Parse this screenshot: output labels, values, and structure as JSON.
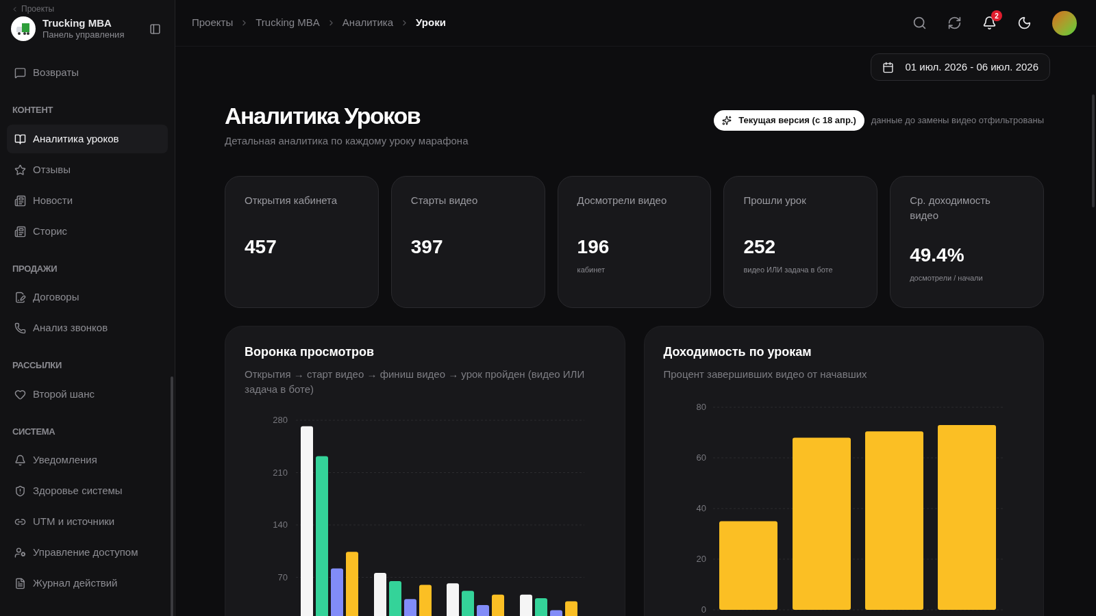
{
  "sidebar": {
    "back_link": "Проекты",
    "project": {
      "name": "Trucking MBA",
      "subtitle": "Панель управления"
    },
    "sections": [
      {
        "items": [
          {
            "label": "Возвраты",
            "selected": false
          }
        ]
      },
      {
        "label": "КОНТЕНТ",
        "items": [
          {
            "label": "Аналитика уроков",
            "selected": true
          },
          {
            "label": "Отзывы",
            "selected": false
          },
          {
            "label": "Новости",
            "selected": false
          },
          {
            "label": "Сторис",
            "selected": false
          }
        ]
      },
      {
        "label": "ПРОДАЖИ",
        "items": [
          {
            "label": "Договоры",
            "selected": false
          },
          {
            "label": "Анализ звонков",
            "selected": false
          }
        ]
      },
      {
        "label": "РАССЫЛКИ",
        "items": [
          {
            "label": "Второй шанс",
            "selected": false
          }
        ]
      },
      {
        "label": "СИСТЕМА",
        "items": [
          {
            "label": "Уведомления",
            "selected": false
          },
          {
            "label": "Здоровье системы",
            "selected": false
          },
          {
            "label": "UTM и источники",
            "selected": false
          },
          {
            "label": "Управление доступом",
            "selected": false
          },
          {
            "label": "Журнал действий",
            "selected": false
          }
        ]
      }
    ]
  },
  "breadcrumbs": [
    {
      "label": "Проекты",
      "current": false
    },
    {
      "label": "Trucking MBA",
      "current": false
    },
    {
      "label": "Аналитика",
      "current": false
    },
    {
      "label": "Уроки",
      "current": true
    }
  ],
  "notifications": {
    "count": "2"
  },
  "date_range": "01 июл. 2026 - 06 июл. 2026",
  "page": {
    "title": "Аналитика Уроков",
    "subtitle": "Детальная аналитика по каждому уроку марафона",
    "version_badge": "Текущая версия (с 18 апр.)",
    "version_note": "данные до замены видео отфильтрованы"
  },
  "stats": [
    {
      "label": "Открытия кабинета",
      "value": "457"
    },
    {
      "label": "Старты видео",
      "value": "397"
    },
    {
      "label": "Досмотрели видео",
      "value": "196",
      "note": "кабинет"
    },
    {
      "label": "Прошли урок",
      "value": "252",
      "note": "видео ИЛИ задача в боте"
    },
    {
      "label": "Ср. доходимость видео",
      "value": "49.4%",
      "note": "досмотрели / начали"
    }
  ],
  "funnel": {
    "title": "Воронка просмотров",
    "subtitle": "Открытия → старт видео → финиш видео → урок пройден (видео ИЛИ задача в боте)",
    "chart_data": {
      "type": "bar",
      "grid": true,
      "yticks": [
        70,
        140,
        210,
        280
      ],
      "ylim": [
        0,
        280
      ],
      "series": [
        {
          "color": "#f5f5f5",
          "values": [
            272,
            76,
            62,
            47
          ]
        },
        {
          "color": "#34d399",
          "values": [
            232,
            65,
            52,
            42
          ]
        },
        {
          "color": "#818cf8",
          "values": [
            82,
            41,
            33,
            26
          ]
        },
        {
          "color": "#fbbf24",
          "values": [
            104,
            60,
            47,
            38
          ]
        }
      ]
    }
  },
  "completion": {
    "title": "Доходимость по урокам",
    "subtitle": "Процент завершивших видео от начавших",
    "chart_data": {
      "type": "bar",
      "grid": true,
      "yticks": [
        0,
        20,
        40,
        60,
        80
      ],
      "ylim": [
        0,
        80
      ],
      "series": [
        {
          "color": "#fbbf24",
          "values": [
            35,
            68,
            70.5,
            73
          ]
        }
      ]
    }
  }
}
